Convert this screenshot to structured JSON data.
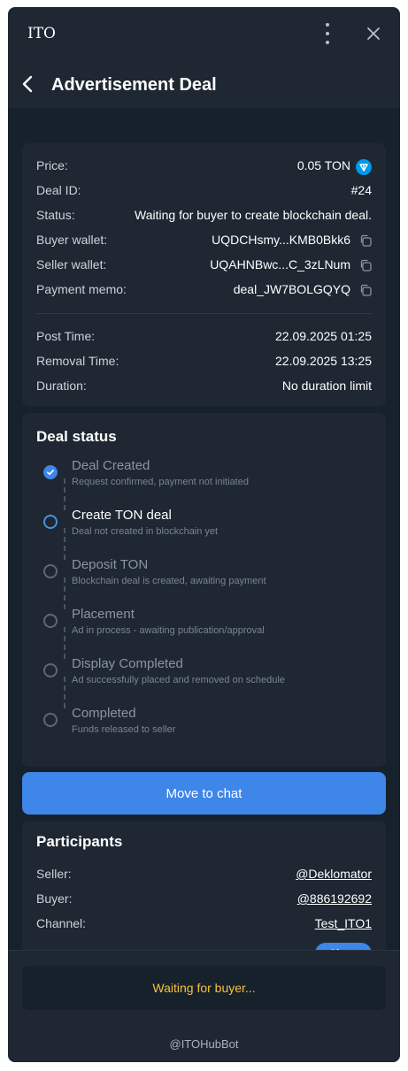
{
  "window": {
    "app_title": "ITO"
  },
  "header": {
    "title": "Advertisement Deal"
  },
  "deal": {
    "price_label": "Price:",
    "price_value": "0.05 TON",
    "id_label": "Deal ID:",
    "id_value": "#24",
    "status_label": "Status:",
    "status_value": "Waiting for buyer to create blockchain deal.",
    "buyer_wallet_label": "Buyer wallet:",
    "buyer_wallet_value": "UQDCHsmy...KMB0Bkk6",
    "seller_wallet_label": "Seller wallet:",
    "seller_wallet_value": "UQAHNBwc...C_3zLNum",
    "memo_label": "Payment memo:",
    "memo_value": "deal_JW7BOLGQYQ",
    "post_time_label": "Post Time:",
    "post_time_value": "22.09.2025 01:25",
    "removal_time_label": "Removal Time:",
    "removal_time_value": "22.09.2025 13:25",
    "duration_label": "Duration:",
    "duration_value": "No duration limit"
  },
  "deal_status": {
    "title": "Deal status",
    "steps": [
      {
        "title": "Deal Created",
        "desc": "Request confirmed, payment not initiated",
        "state": "done"
      },
      {
        "title": "Create TON deal",
        "desc": "Deal not created in blockchain yet",
        "state": "current"
      },
      {
        "title": "Deposit TON",
        "desc": "Blockchain deal is created, awaiting payment",
        "state": "pending"
      },
      {
        "title": "Placement",
        "desc": "Ad in process - awaiting publication/approval",
        "state": "pending"
      },
      {
        "title": "Display Completed",
        "desc": "Ad successfully placed and removed on schedule",
        "state": "pending"
      },
      {
        "title": "Completed",
        "desc": "Funds released to seller",
        "state": "pending"
      }
    ]
  },
  "actions": {
    "move_to_chat": "Move to chat"
  },
  "participants": {
    "title": "Participants",
    "seller_label": "Seller:",
    "seller_value": "@Deklomator",
    "buyer_label": "Buyer:",
    "buyer_value": "@886192692",
    "channel_label": "Channel:",
    "channel_value": "Test_ITO1",
    "show_label": "Show"
  },
  "footer": {
    "waiting": "Waiting for buyer...",
    "bot": "@ITOHubBot"
  },
  "colors": {
    "accent": "#3e86e8",
    "warning": "#f5c33b",
    "background": "#17212b",
    "card": "#1e2732"
  },
  "icons": {
    "menu": "more-vertical-icon",
    "close": "close-icon",
    "back": "chevron-left-icon",
    "copy": "copy-icon",
    "currency": "ton-icon",
    "check": "check-icon"
  }
}
